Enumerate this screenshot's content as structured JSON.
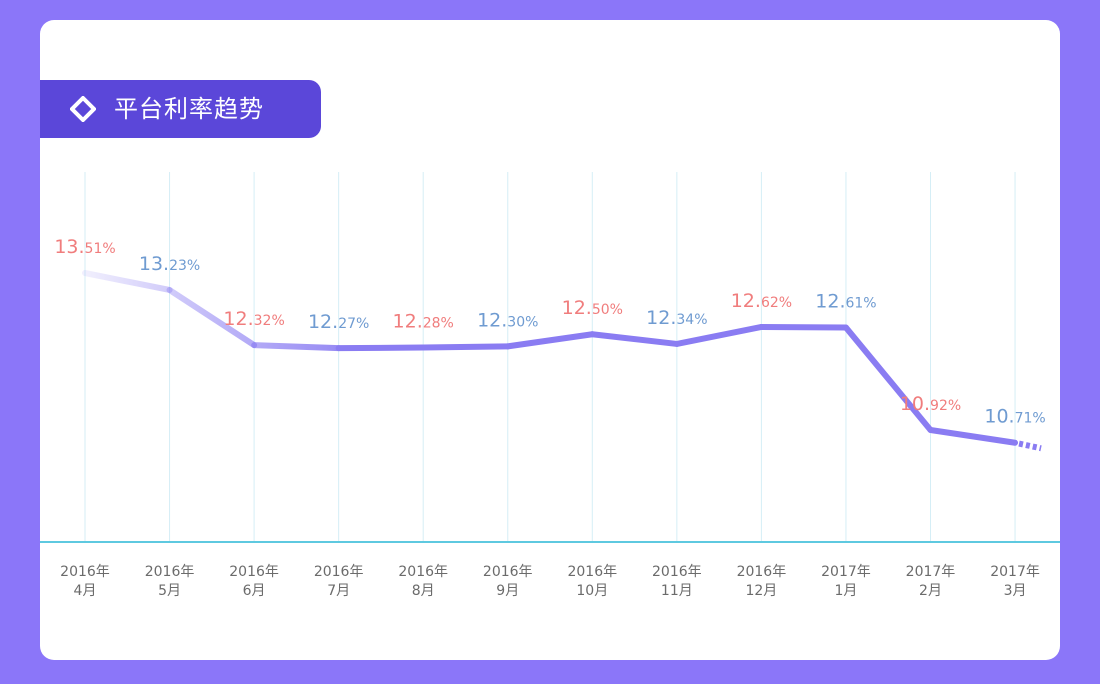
{
  "header": {
    "title": "平台利率趋势",
    "icon": "diamond-outline-icon"
  },
  "colors": {
    "background": "#8b76f9",
    "title_tag": "#5b47d9",
    "line": "#8a7cf2",
    "axis": "#5ec9e0",
    "grid": "#d5eef6",
    "label_red": "#f07d7d",
    "label_blue": "#6f9bd1"
  },
  "chart_data": {
    "type": "line",
    "title": "平台利率趋势",
    "categories": [
      [
        "2016年",
        "4月"
      ],
      [
        "2016年",
        "5月"
      ],
      [
        "2016年",
        "6月"
      ],
      [
        "2016年",
        "7月"
      ],
      [
        "2016年",
        "8月"
      ],
      [
        "2016年",
        "9月"
      ],
      [
        "2016年",
        "10月"
      ],
      [
        "2016年",
        "11月"
      ],
      [
        "2016年",
        "12月"
      ],
      [
        "2017年",
        "1月"
      ],
      [
        "2017年",
        "2月"
      ],
      [
        "2017年",
        "3月"
      ]
    ],
    "series": [
      {
        "values": [
          13.51,
          13.23,
          12.32,
          12.27,
          12.28,
          12.3,
          12.5,
          12.34,
          12.62,
          12.61,
          10.92,
          10.71
        ]
      }
    ],
    "data_labels": [
      {
        "int": "13.",
        "dec": "51%",
        "color": "red"
      },
      {
        "int": "13.",
        "dec": "23%",
        "color": "blue"
      },
      {
        "int": "12.",
        "dec": "32%",
        "color": "red"
      },
      {
        "int": "12.",
        "dec": "27%",
        "color": "blue"
      },
      {
        "int": "12.",
        "dec": "28%",
        "color": "red"
      },
      {
        "int": "12.",
        "dec": "30%",
        "color": "blue"
      },
      {
        "int": "12.",
        "dec": "50%",
        "color": "red"
      },
      {
        "int": "12.",
        "dec": "34%",
        "color": "blue"
      },
      {
        "int": "12.",
        "dec": "62%",
        "color": "red"
      },
      {
        "int": "12.",
        "dec": "61%",
        "color": "blue"
      },
      {
        "int": "10.",
        "dec": "92%",
        "color": "red"
      },
      {
        "int": "10.",
        "dec": "71%",
        "color": "blue"
      }
    ],
    "grid": true,
    "legend": "none"
  }
}
